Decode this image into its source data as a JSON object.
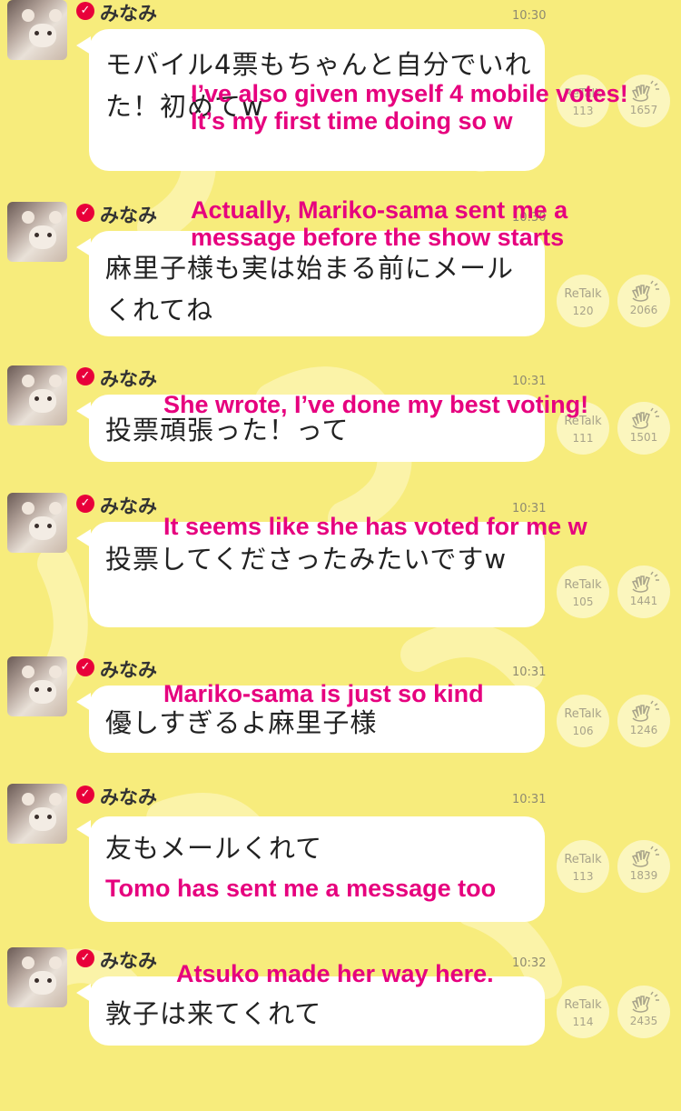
{
  "messages": [
    {
      "author": "みなみ",
      "time": "10:30",
      "text": "モバイル4票もちゃんと自分でいれた！初めてw",
      "retalk_label": "ReTalk",
      "retalk_count": "113",
      "clap_count": "1657",
      "translation": [
        "I’ve also given myself 4 mobile votes!",
        "It’s my first time doing so w"
      ]
    },
    {
      "author": "みなみ",
      "time": "10:30",
      "text": "麻里子様も実は始まる前にメールくれてね",
      "retalk_label": "ReTalk",
      "retalk_count": "120",
      "clap_count": "2066",
      "translation": [
        "Actually, Mariko-sama sent me a",
        "message before the show starts"
      ]
    },
    {
      "author": "みなみ",
      "time": "10:31",
      "text": "投票頑張った！って",
      "retalk_label": "ReTalk",
      "retalk_count": "111",
      "clap_count": "1501",
      "translation": [
        "She wrote, I’ve done my best voting!"
      ]
    },
    {
      "author": "みなみ",
      "time": "10:31",
      "text": "投票してくださったみたいですw",
      "retalk_label": "ReTalk",
      "retalk_count": "105",
      "clap_count": "1441",
      "translation": [
        "It seems like she has voted for me w"
      ]
    },
    {
      "author": "みなみ",
      "time": "10:31",
      "text": "優しすぎるよ麻里子様",
      "retalk_label": "ReTalk",
      "retalk_count": "106",
      "clap_count": "1246",
      "translation": [
        "Mariko-sama is just so kind"
      ]
    },
    {
      "author": "みなみ",
      "time": "10:31",
      "text": "友もメールくれて",
      "retalk_label": "ReTalk",
      "retalk_count": "113",
      "clap_count": "1839",
      "translation": [
        "Tomo has sent me a message too"
      ]
    },
    {
      "author": "みなみ",
      "time": "10:32",
      "text": "敦子は来てくれて",
      "retalk_label": "ReTalk",
      "retalk_count": "114",
      "clap_count": "2435",
      "translation": [
        "Atsuko made her way here."
      ]
    }
  ]
}
